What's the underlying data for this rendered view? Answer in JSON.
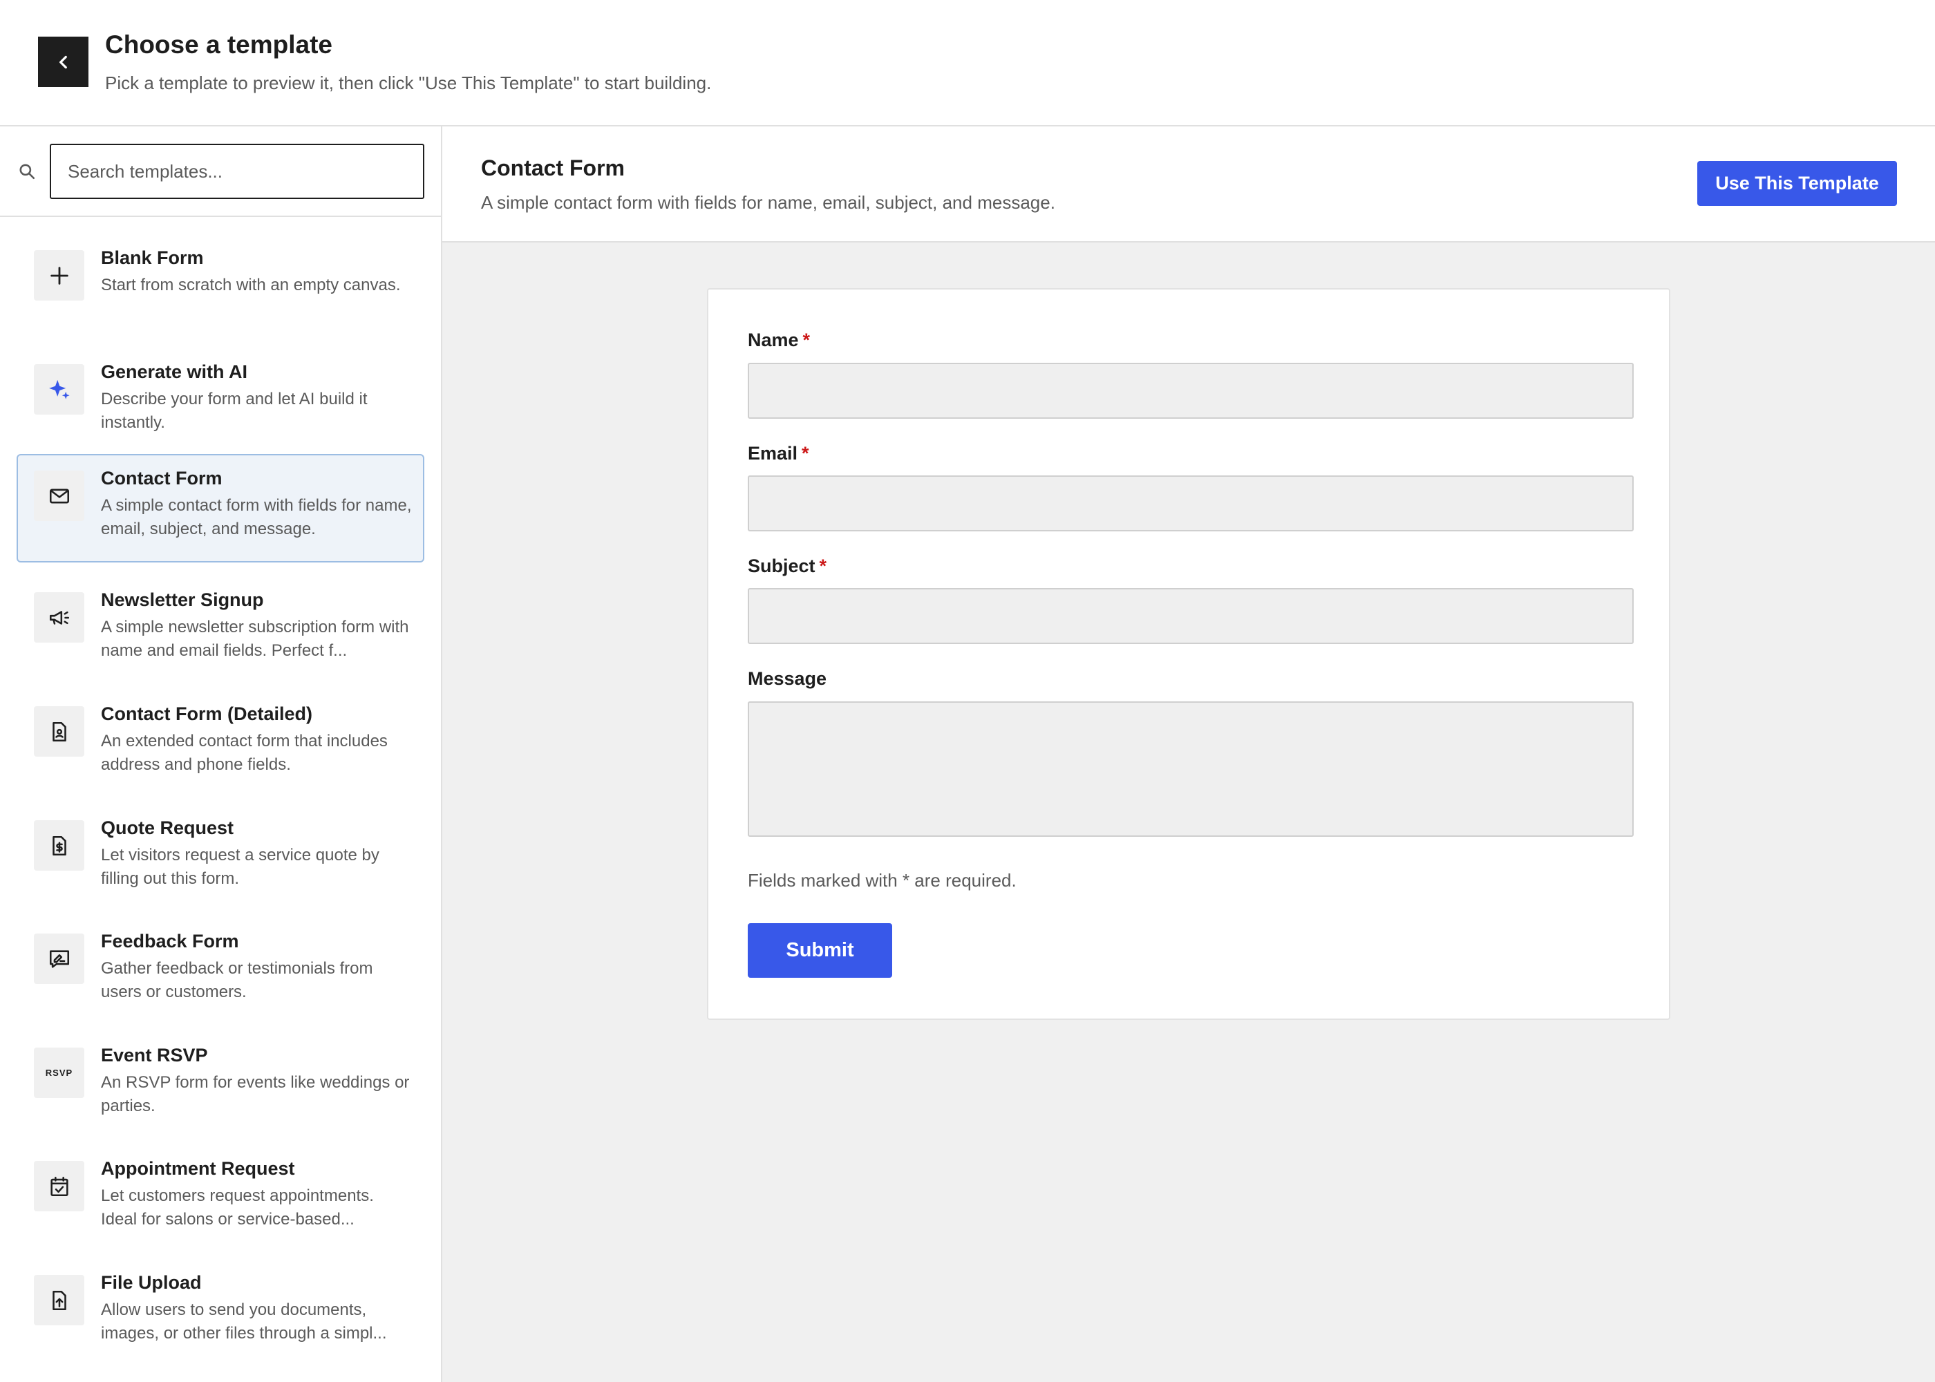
{
  "header": {
    "title": "Choose a template",
    "subtitle": "Pick a template to preview it, then click \"Use This Template\" to start building.",
    "back_icon": "chevron-left-icon"
  },
  "sidebar": {
    "search_placeholder": "Search templates...",
    "search_icon": "search-icon",
    "selected": "Contact Form",
    "templates": [
      {
        "title": "Blank Form",
        "desc": "Start from scratch with an empty canvas.",
        "icon": "plus-icon"
      },
      {
        "title": "Generate with AI",
        "desc": "Describe your form and let AI build it instantly.",
        "icon": "sparkle-icon"
      },
      {
        "title": "Contact Form",
        "desc": "A simple contact form with fields for name, email, subject, and message.",
        "icon": "envelope-icon"
      },
      {
        "title": "Newsletter Signup",
        "desc": "A simple newsletter subscription form with name and email fields. Perfect f...",
        "icon": "megaphone-icon"
      },
      {
        "title": "Contact Form (Detailed)",
        "desc": "An extended contact form that includes address and phone fields.",
        "icon": "contact-document-icon"
      },
      {
        "title": "Quote Request",
        "desc": "Let visitors request a service quote by filling out this form.",
        "icon": "dollar-document-icon"
      },
      {
        "title": "Feedback Form",
        "desc": "Gather feedback or testimonials from users or customers.",
        "icon": "feedback-icon"
      },
      {
        "title": "Event RSVP",
        "desc": "An RSVP form for events like weddings or parties.",
        "icon": "rsvp-icon",
        "icon_text": "RSVP"
      },
      {
        "title": "Appointment Request",
        "desc": "Let customers request appointments. Ideal for salons or service-based...",
        "icon": "calendar-check-icon"
      },
      {
        "title": "File Upload",
        "desc": "Allow users to send you documents, images, or other files through a simpl...",
        "icon": "file-upload-icon"
      }
    ]
  },
  "preview": {
    "title": "Contact Form",
    "desc": "A simple contact form with fields for name, email, subject, and message.",
    "use_button": "Use This Template",
    "accent_color": "#3858e9",
    "form": {
      "fields": [
        {
          "label": "Name",
          "required": "*",
          "type": "input",
          "value": ""
        },
        {
          "label": "Email",
          "required": "*",
          "type": "input",
          "value": ""
        },
        {
          "label": "Subject",
          "required": "*",
          "type": "input",
          "value": ""
        },
        {
          "label": "Message",
          "required": "",
          "type": "textarea",
          "value": ""
        }
      ],
      "note": "Fields marked with * are required.",
      "submit": "Submit"
    }
  }
}
